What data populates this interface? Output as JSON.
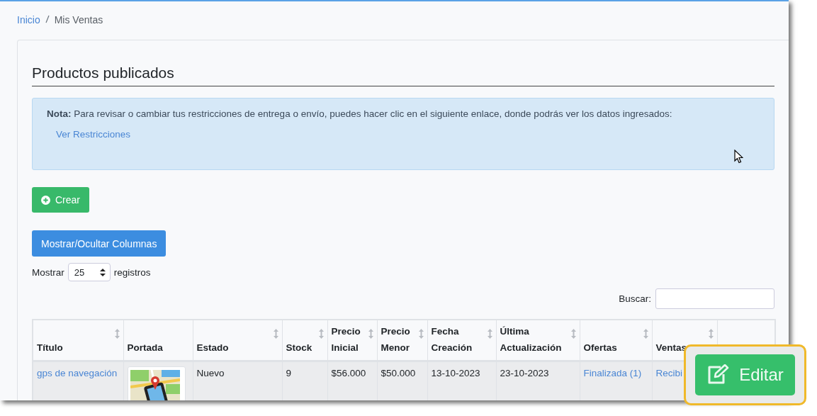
{
  "breadcrumb": [
    {
      "label": "Inicio",
      "link": true
    },
    {
      "label": "Mis Ventas",
      "link": false
    }
  ],
  "title": "Productos publicados",
  "note": {
    "text": "**Nota:** Para revisar o cambiar tus restricciones de entrega o envío, puedes hacer clic en el siguiente enlace, donde podrás ver los datos ingresados:",
    "link": "Ver Restricciones"
  },
  "create_button": "Crear",
  "columns_button": "Mostrar/Ocultar Columnas",
  "page_length": {
    "prefix": "Mostrar",
    "value": "25",
    "suffix": "registros"
  },
  "search": {
    "label": "Buscar:"
  },
  "table": {
    "columns": [
      {
        "label": "Título",
        "sortable": true
      },
      {
        "label": "Portada",
        "sortable": false
      },
      {
        "label": "Estado",
        "sortable": true
      },
      {
        "label": "Stock",
        "sortable": true
      },
      {
        "label": "Precio Inicial",
        "sortable": true
      },
      {
        "label": "Precio Menor",
        "sortable": true
      },
      {
        "label": "Fecha Creación",
        "sortable": true
      },
      {
        "label": "Última Actualización",
        "sortable": true
      },
      {
        "label": "Ofertas",
        "sortable": true
      },
      {
        "label": "Ventas",
        "sortable": true
      },
      {
        "sortable": false
      }
    ],
    "rows": [
      {
        "cells": [
          {
            "kind": "link",
            "text": "gps de navegación"
          },
          {
            "kind": "picture"
          },
          {
            "kind": "text",
            "text": "Nuevo"
          },
          {
            "kind": "text",
            "text": "9"
          },
          {
            "kind": "text",
            "text": "$56.000"
          },
          {
            "kind": "text",
            "text": "$50.000"
          },
          {
            "kind": "text",
            "text": "13-10-2023"
          },
          {
            "kind": "text",
            "text": "23-10-2023"
          },
          {
            "kind": "link",
            "text": "Finalizada (1)"
          },
          {
            "kind": "link",
            "text": "Recibi"
          },
          {
            "kind": "empty"
          }
        ]
      }
    ]
  },
  "callout": {
    "label": "Editar"
  }
}
